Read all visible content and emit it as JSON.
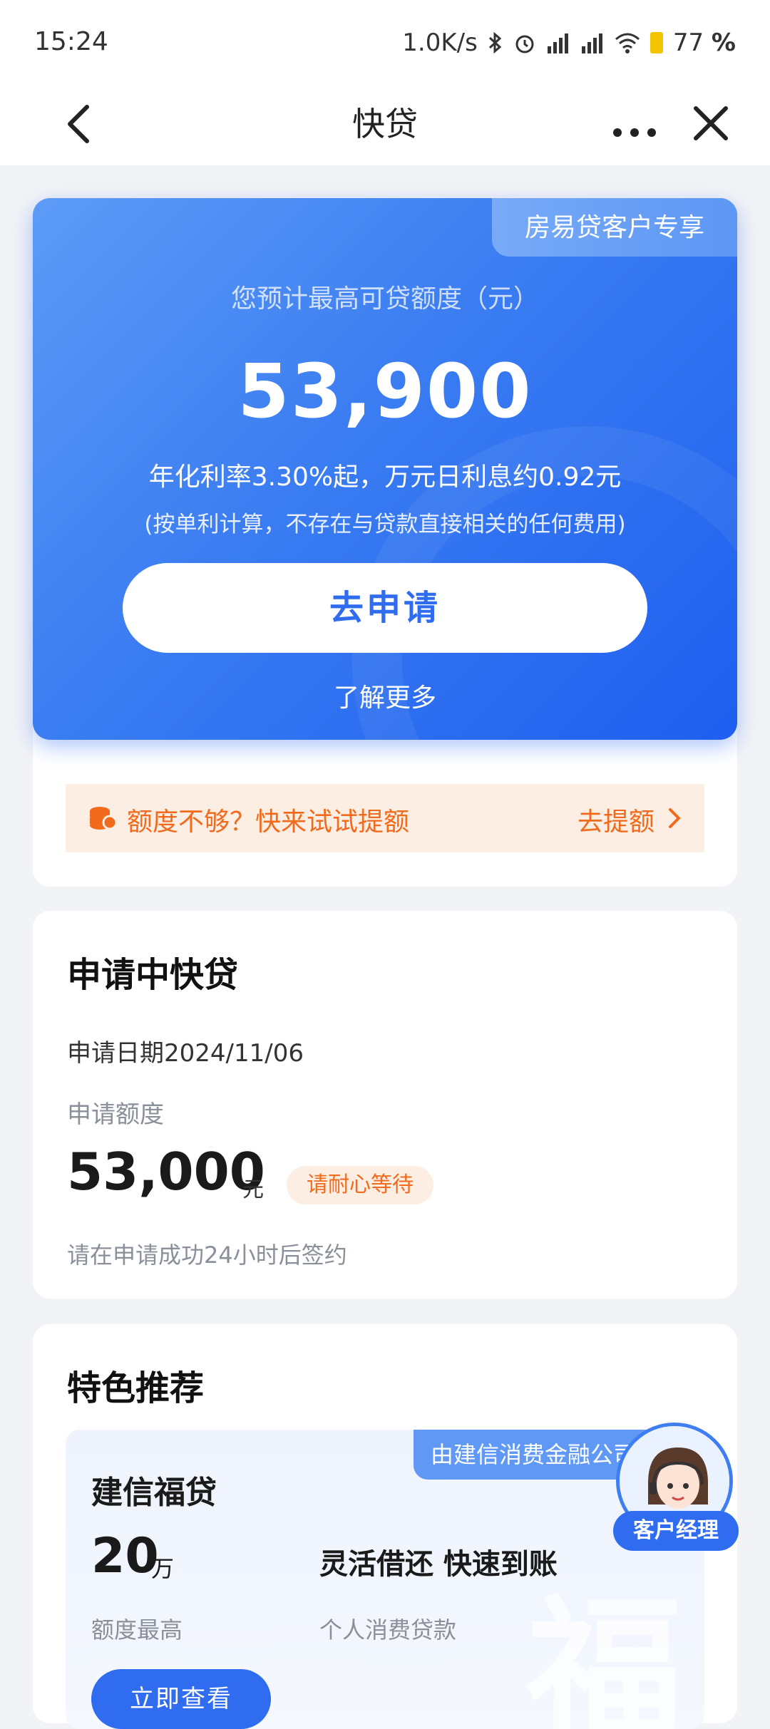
{
  "status_bar": {
    "time": "15:24",
    "speed": "1.0K/s",
    "battery": "77",
    "battery_unit": "%"
  },
  "nav": {
    "title": "快贷"
  },
  "hero": {
    "tag": "房易贷客户专享",
    "label": "您预计最高可贷额度（元）",
    "amount": "53,900",
    "rate": "年化利率3.30%起，万元日利息约0.92元",
    "note": "(按单利计算，不存在与贷款直接相关的任何费用)",
    "apply_button": "去申请",
    "learn_more": "了解更多",
    "accent": "#2f6cf0"
  },
  "limit_bar": {
    "text": "额度不够？快来试试提额",
    "link": "去提额"
  },
  "application": {
    "title": "申请中快贷",
    "date": "申请日期2024/11/06",
    "amount_label": "申请额度",
    "amount": "53,000",
    "unit": "元",
    "status": "请耐心等待",
    "tip": "请在申请成功24小时后签约"
  },
  "recommend": {
    "title": "特色推荐",
    "product": {
      "tag": "由建信消费金融公司",
      "name": "建信福贷",
      "quota": "20",
      "quota_unit": "万",
      "features": "灵活借还 快速到账",
      "quota_label": "额度最高",
      "type": "个人消费贷款",
      "button": "立即查看"
    }
  },
  "agent": {
    "label": "客户经理"
  }
}
